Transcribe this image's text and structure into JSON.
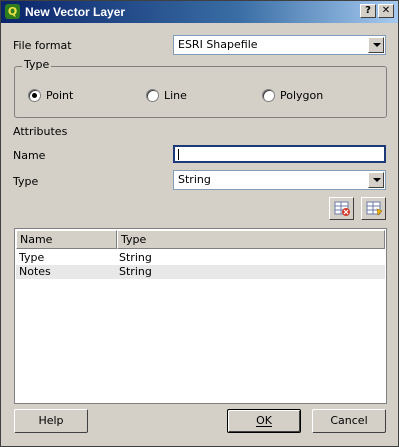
{
  "window": {
    "title": "New Vector Layer",
    "app_icon_letter": "Q"
  },
  "titlebar": {
    "help_btn": "?",
    "close_btn": "✕"
  },
  "file_format": {
    "label": "File format",
    "value": "ESRI Shapefile"
  },
  "type_group": {
    "title": "Type",
    "options": [
      {
        "label": "Point",
        "checked": true
      },
      {
        "label": "Line",
        "checked": false
      },
      {
        "label": "Polygon",
        "checked": false
      }
    ]
  },
  "attributes": {
    "section_label": "Attributes",
    "name_label": "Name",
    "name_value": "",
    "type_label": "Type",
    "type_value": "String"
  },
  "attribute_table": {
    "columns": [
      "Name",
      "Type"
    ],
    "rows": [
      [
        "Type",
        "String"
      ],
      [
        "Notes",
        "String"
      ]
    ]
  },
  "buttons": {
    "help": "Help",
    "ok": "OK",
    "cancel": "Cancel"
  },
  "icons": {
    "remove_attribute": "delete-attribute-icon",
    "add_attribute": "add-attribute-icon"
  }
}
